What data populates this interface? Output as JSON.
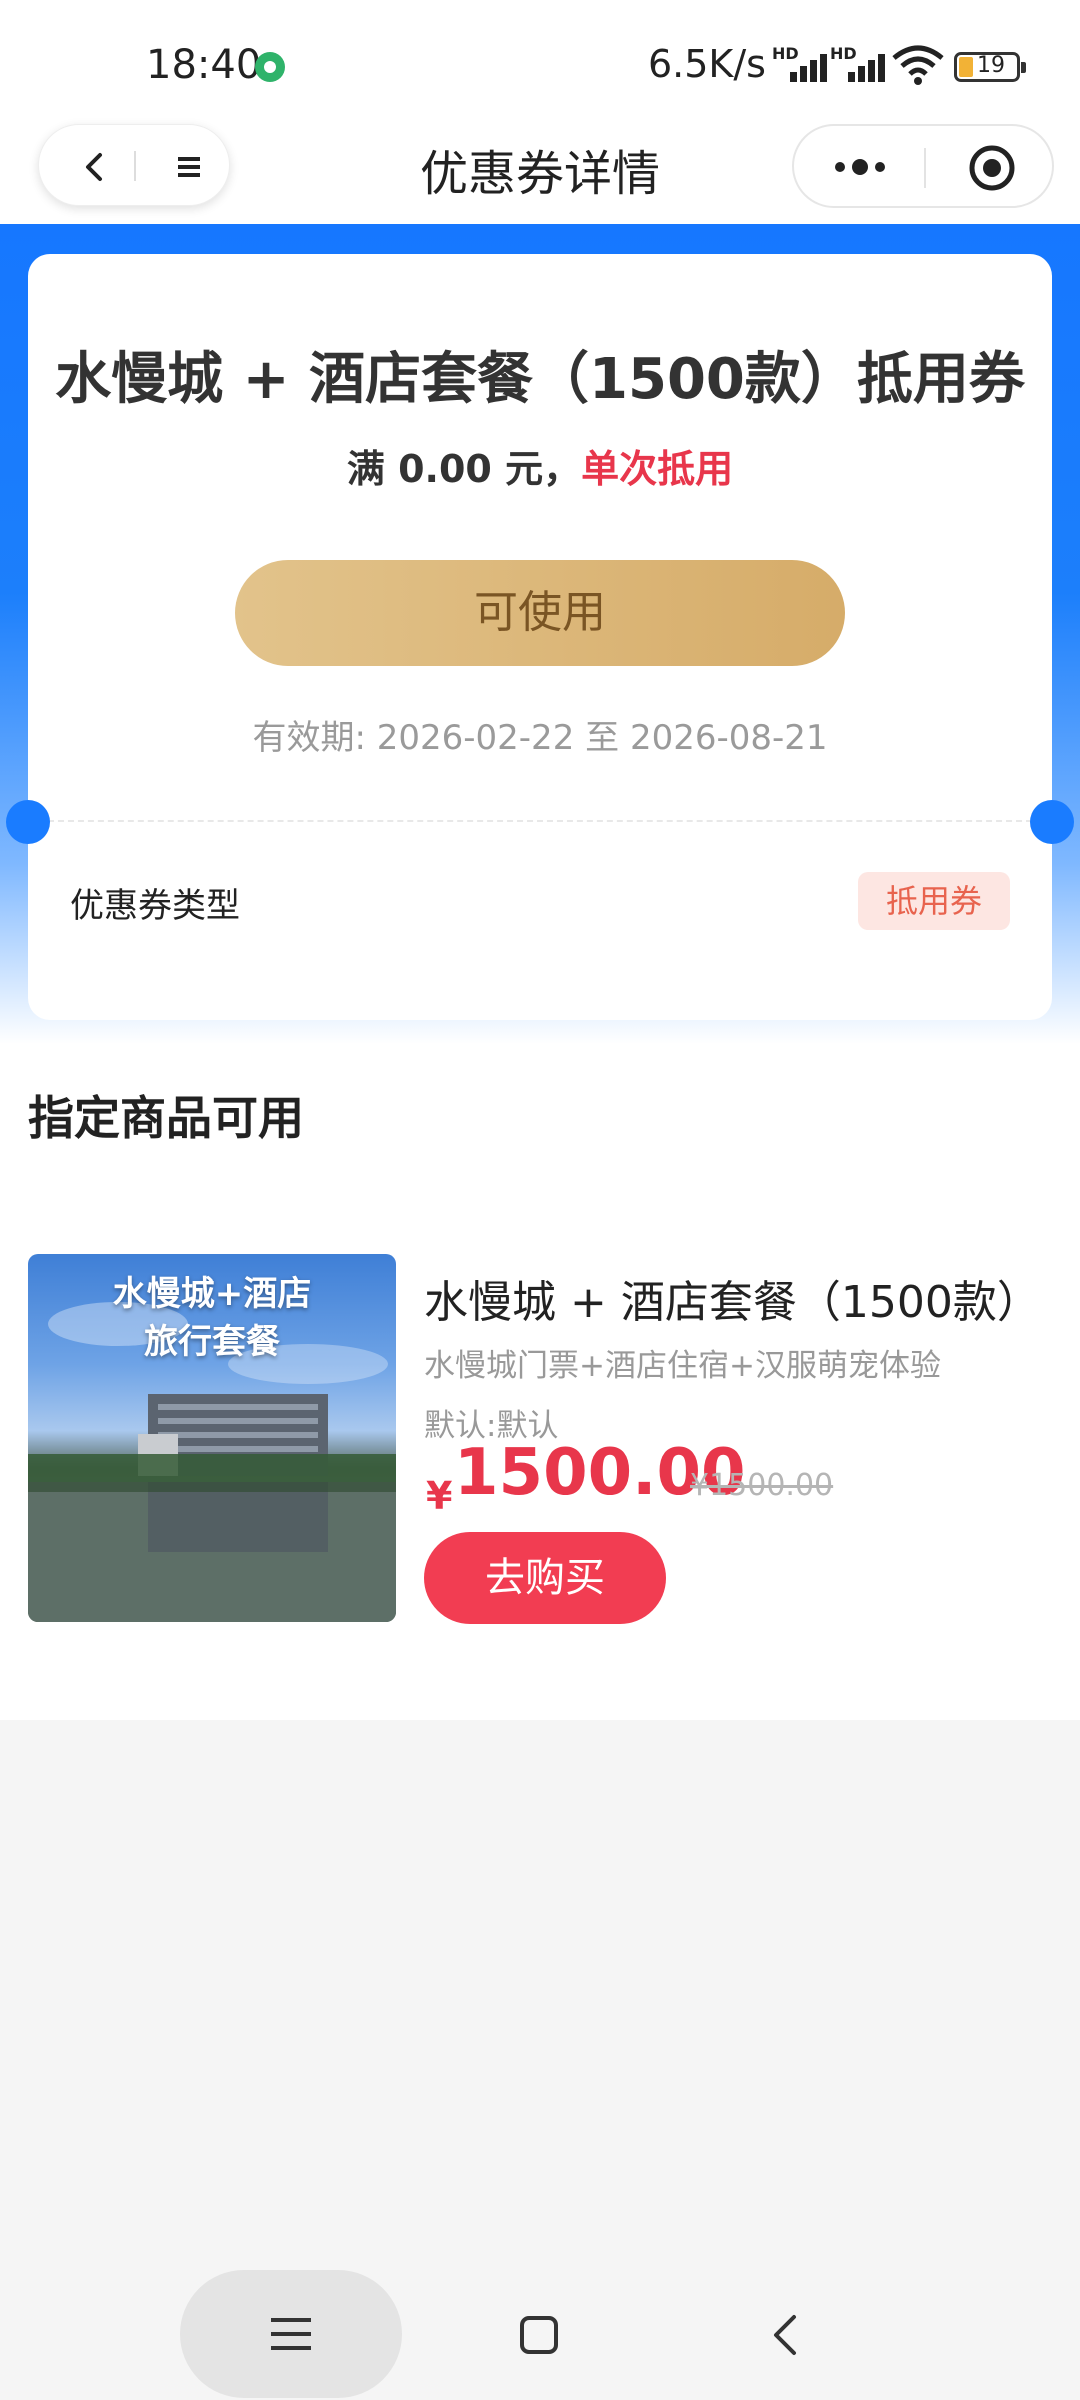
{
  "status_bar": {
    "time": "18:40",
    "speed": "6.5K/s",
    "signal_hd": "HD",
    "battery": "19"
  },
  "title_bar": {
    "title": "优惠券详情"
  },
  "coupon": {
    "title": "水慢城 + 酒店套餐（1500款）抵用券",
    "condition_prefix": "满 0.00 元，",
    "condition_highlight": "单次抵用",
    "use_button": "可使用",
    "validity": "有效期: 2026-02-22 至 2026-08-21",
    "type_label": "优惠券类型",
    "type_value": "抵用券"
  },
  "products": {
    "section_title": "指定商品可用",
    "items": [
      {
        "image_text_line1": "水慢城+酒店",
        "image_text_line2": "旅行套餐",
        "name": "水慢城 + 酒店套餐（1500款）",
        "desc": "水慢城门票+酒店住宿+汉服萌宠体验",
        "spec": "默认:默认",
        "price_symbol": "¥",
        "price": "1500.00",
        "original_price": "¥1500.00",
        "buy_label": "去购买"
      }
    ]
  },
  "colors": {
    "brand_blue": "#1677ff",
    "price_red": "#e8364b",
    "gold": "#d6ac69"
  }
}
